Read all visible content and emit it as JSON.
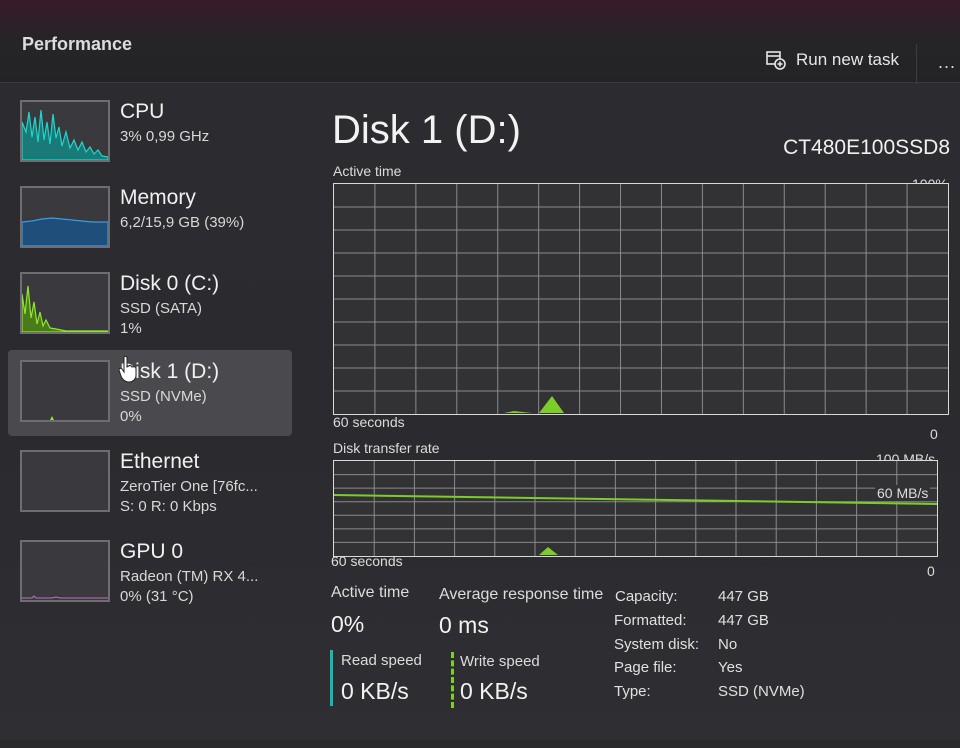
{
  "app": {
    "title": "Performance"
  },
  "toolbar": {
    "run_new_task": "Run new task",
    "more": "..."
  },
  "sidebar": {
    "items": [
      {
        "name": "CPU",
        "sub1": "3% 0,99 GHz",
        "sub2": "",
        "color": "#17b8b0"
      },
      {
        "name": "Memory",
        "sub1": "6,2/15,9 GB (39%)",
        "sub2": "",
        "color": "#1d7fc4"
      },
      {
        "name": "Disk 0 (C:)",
        "sub1": "SSD (SATA)",
        "sub2": "1%",
        "color": "#7ccc2a"
      },
      {
        "name": "Disk 1 (D:)",
        "sub1": "SSD (NVMe)",
        "sub2": "0%",
        "color": "#7ccc2a"
      },
      {
        "name": "Ethernet",
        "sub1": "ZeroTier One [76fc...",
        "sub2": "S: 0 R: 0 Kbps",
        "color": "#c08a3e"
      },
      {
        "name": "GPU 0",
        "sub1": "Radeon (TM) RX 4...",
        "sub2": "0% (31 °C)",
        "color": "#b060b8"
      }
    ]
  },
  "main": {
    "title": "Disk 1 (D:)",
    "model": "CT480E100SSD8",
    "active_graph": {
      "label": "Active time",
      "max": "100%",
      "time": "60 seconds",
      "min": "0"
    },
    "transfer_graph": {
      "label": "Disk transfer rate",
      "max": "100 MB/s",
      "line_label": "60 MB/s",
      "time": "60 seconds",
      "min": "0"
    },
    "stats": {
      "active_time_label": "Active time",
      "active_time_value": "0%",
      "avg_response_label": "Average response time",
      "avg_response_value": "0 ms",
      "read_label": "Read speed",
      "read_value": "0 KB/s",
      "write_label": "Write speed",
      "write_value": "0 KB/s"
    },
    "details": [
      {
        "label": "Capacity:",
        "value": "447 GB"
      },
      {
        "label": "Formatted:",
        "value": "447 GB"
      },
      {
        "label": "System disk:",
        "value": "No"
      },
      {
        "label": "Page file:",
        "value": "Yes"
      },
      {
        "label": "Type:",
        "value": "SSD (NVMe)"
      }
    ]
  },
  "colors": {
    "disk_green": "#7ccc2a",
    "read_accent": "#17b8b0",
    "write_accent": "#7ccc2a"
  }
}
